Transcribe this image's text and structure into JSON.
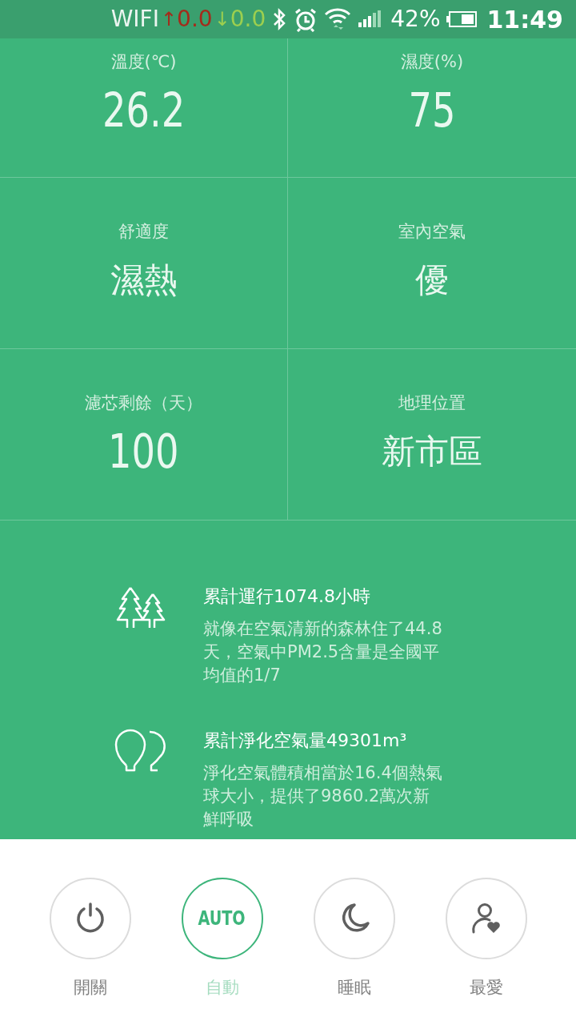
{
  "status_bar": {
    "network": "WIFI",
    "up_arrow": "↑",
    "up_rate": "0.0",
    "down_arrow": "↓",
    "down_rate": "0.0",
    "battery": "42%",
    "time": "11:49"
  },
  "tiles": [
    {
      "label": "溫度(℃)",
      "value": "26.2",
      "kind": "number"
    },
    {
      "label": "濕度(%)",
      "value": "75",
      "kind": "number"
    },
    {
      "label": "舒適度",
      "value": "濕熱",
      "kind": "word"
    },
    {
      "label": "室內空氣",
      "value": "優",
      "kind": "word"
    },
    {
      "label": "濾芯剩餘（天）",
      "value": "100",
      "kind": "number"
    },
    {
      "label": "地理位置",
      "value": "新市區",
      "kind": "word"
    }
  ],
  "stats": [
    {
      "kind": "trees",
      "title": "累計運行1074.8小時",
      "description": "就像在空氣清新的森林住了44.8天，空氣中PM2.5含量是全國平均值的1/7"
    },
    {
      "kind": "balloons",
      "title": "累計淨化空氣量49301m³",
      "description": "淨化空氣體積相當於16.4個熱氣球大小，提供了9860.2萬次新鮮呼吸"
    }
  ],
  "modes": [
    {
      "kind": "power",
      "label": "開關",
      "selected": false
    },
    {
      "kind": "text",
      "text": "AUTO",
      "label": "自動",
      "selected": true
    },
    {
      "kind": "moon",
      "label": "睡眠",
      "selected": false
    },
    {
      "kind": "user-heart",
      "label": "最愛",
      "selected": false
    }
  ]
}
